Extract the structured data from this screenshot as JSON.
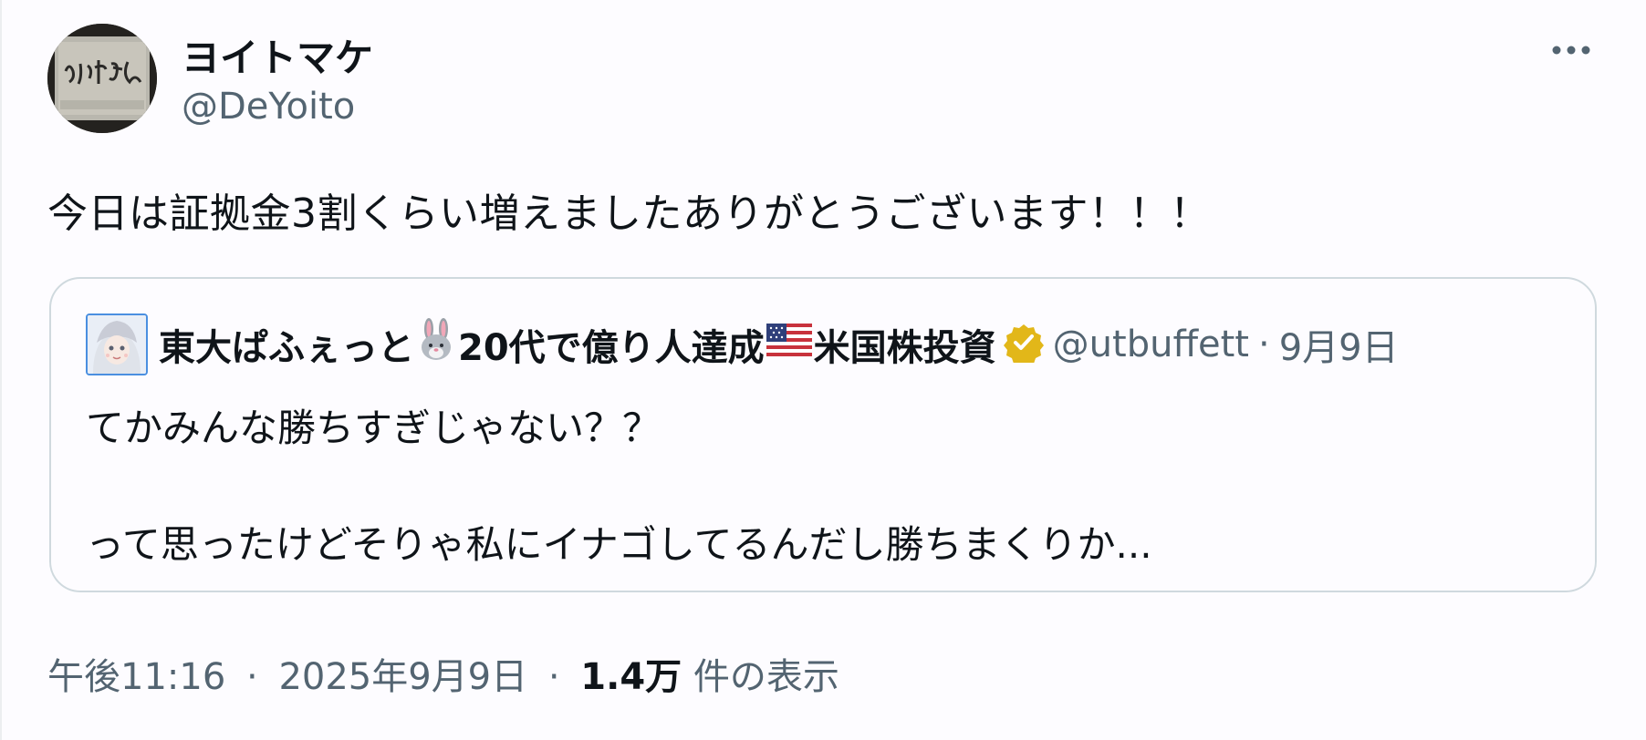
{
  "author": {
    "display_name": "ヨイトマケ",
    "handle": "@DeYoito",
    "avatar_icon": "avatar-handwritten-yoitoman"
  },
  "more_icon": "more-options-icon",
  "tweet": {
    "text": "今日は証拠金3割くらい増えましたありがとうございます！！！"
  },
  "quote": {
    "name_part1": "東大ぱふぇっと",
    "name_part2": "20代で億り人達成",
    "name_part3": "米国株投資",
    "rabbit_icon": "rabbit-emoji-icon",
    "flag_icon": "us-flag-emoji-icon",
    "verified_icon": "verified-gold-badge-icon",
    "handle": "@utbuffett",
    "dot": "·",
    "date": "9月9日",
    "line1": "てかみんな勝ちすぎじゃない？？",
    "line2": "って思ったけどそりゃ私にイナゴしてるんだし勝ちまくりか..."
  },
  "meta": {
    "time": "午後11:16",
    "sep1": "·",
    "date": "2025年9月9日",
    "sep2": "·",
    "views_count": "1.4万",
    "views_label": "件の表示"
  },
  "colors": {
    "text_primary": "#0f1419",
    "text_secondary": "#536471",
    "border": "#cfd9de",
    "verified_gold": "#e2b719"
  }
}
